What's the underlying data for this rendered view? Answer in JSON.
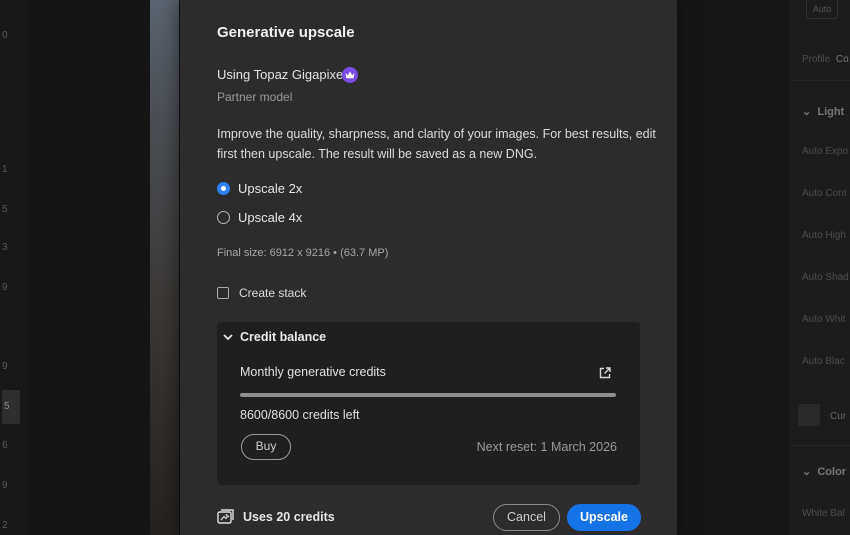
{
  "background": {
    "left_strip_numbers": [
      "0",
      "1",
      "5",
      "3",
      "9",
      "9",
      "5",
      "6",
      "9",
      "2"
    ],
    "right_panel": {
      "auto_label": "Auto",
      "profile_label": "Profile",
      "profile_value": "Co",
      "light_section": "Light",
      "items": [
        "Auto Expo",
        "Auto Cont",
        "Auto High",
        "Auto Shad",
        "Auto Whit",
        "Auto Blac"
      ],
      "curve_label": "Cur",
      "color_section": "Color",
      "white_balance": "White Bal"
    }
  },
  "dialog": {
    "title": "Generative upscale",
    "using_label": "Using Topaz Gigapixel",
    "partner_label": "Partner model",
    "description": "Improve the quality, sharpness, and clarity of your images. For best results, edit first then upscale. The result will be saved as a new DNG.",
    "options": [
      {
        "label": "Upscale 2x",
        "selected": true
      },
      {
        "label": "Upscale 4x",
        "selected": false
      }
    ],
    "final_size": "Final size: 6912 x 9216 • (63.7 MP)",
    "create_stack_label": "Create stack",
    "create_stack_checked": false,
    "credit": {
      "header": "Credit balance",
      "monthly_label": "Monthly generative credits",
      "used": 8600,
      "total": 8600,
      "credits_left_label": "8600/8600 credits left",
      "buy_label": "Buy",
      "next_reset": "Next reset: 1 March 2026"
    },
    "uses_credits_label": "Uses 20 credits",
    "cancel_label": "Cancel",
    "upscale_label": "Upscale"
  },
  "colors": {
    "accent": "#1473e6",
    "radio_selected": "#2f82f5",
    "crown_badge": "#7a4ce8",
    "dialog_bg": "#2c2c2c"
  },
  "icons": {
    "crown": "crown-icon",
    "chevron": "chevron-down-icon",
    "external": "external-link-icon",
    "credits": "credits-icon"
  }
}
